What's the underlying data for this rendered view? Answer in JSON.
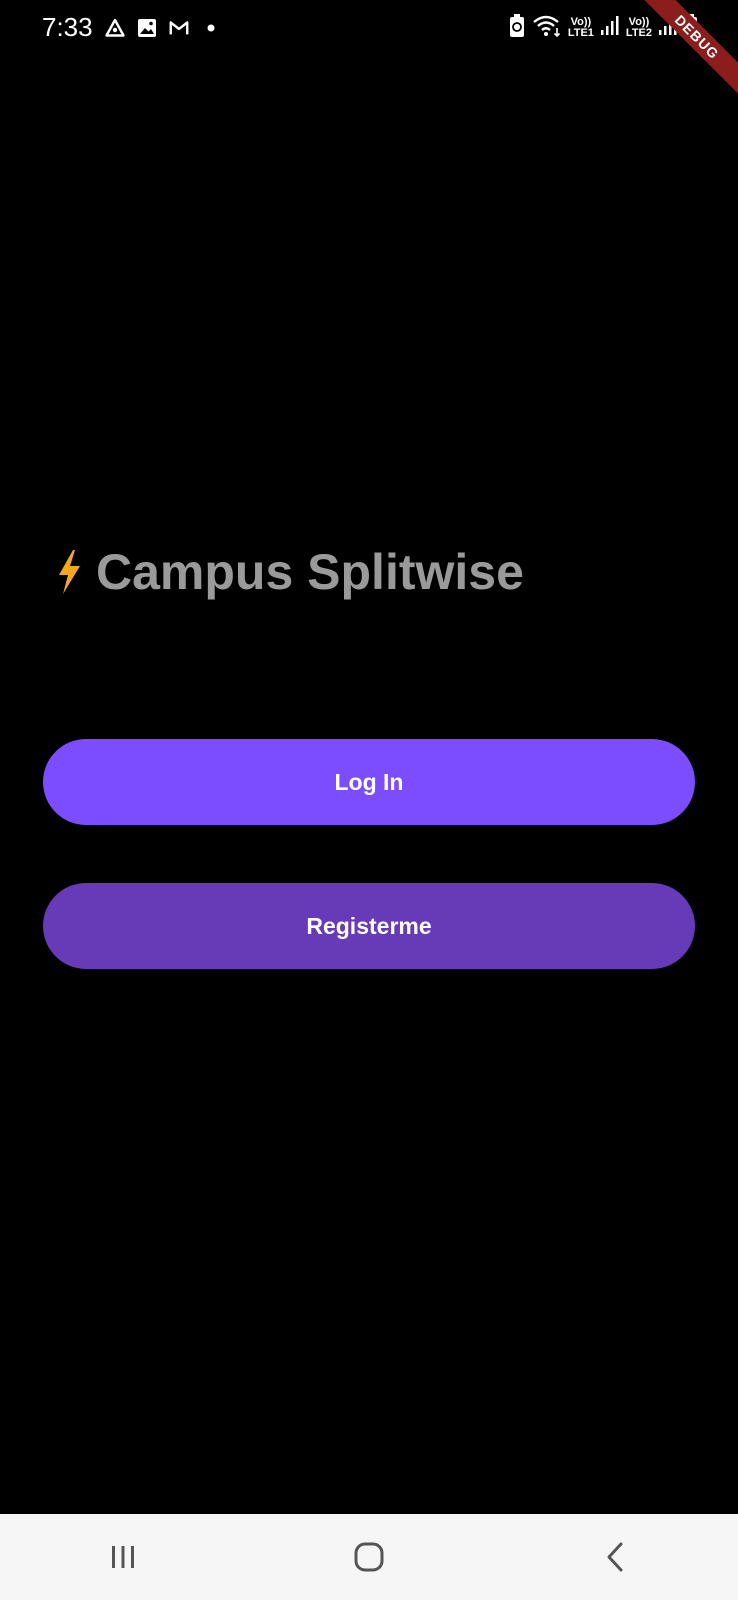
{
  "status_bar": {
    "time": "7:33",
    "left_icons": [
      "assistant-triangle-icon",
      "gallery-icon",
      "gmail-icon",
      "notification-dot-icon"
    ],
    "right_icons": [
      "battery-saver-icon",
      "wifi-icon",
      "signal-sim1-icon",
      "signal-sim2-icon",
      "battery-icon"
    ],
    "sim1_top": "Vo))",
    "sim1_bottom": "LTE1",
    "sim2_top": "Vo))",
    "sim2_bottom": "LTE2"
  },
  "debug_banner": "DEBUG",
  "app": {
    "icon": "lightning-bolt-icon",
    "title": "Campus Splitwise"
  },
  "actions": {
    "login_label": "Log In",
    "register_label": "Registerme"
  },
  "nav_bar": {
    "items": [
      "recent-apps-icon",
      "home-icon",
      "back-icon"
    ]
  },
  "colors": {
    "background": "#000000",
    "title_text": "#9a9a9a",
    "login_button": "#7c4dff",
    "register_button": "#673ab7",
    "debug_ribbon": "#8b1d1d",
    "nav_bar": "#f6f6f6",
    "bolt": "#f5a623"
  }
}
